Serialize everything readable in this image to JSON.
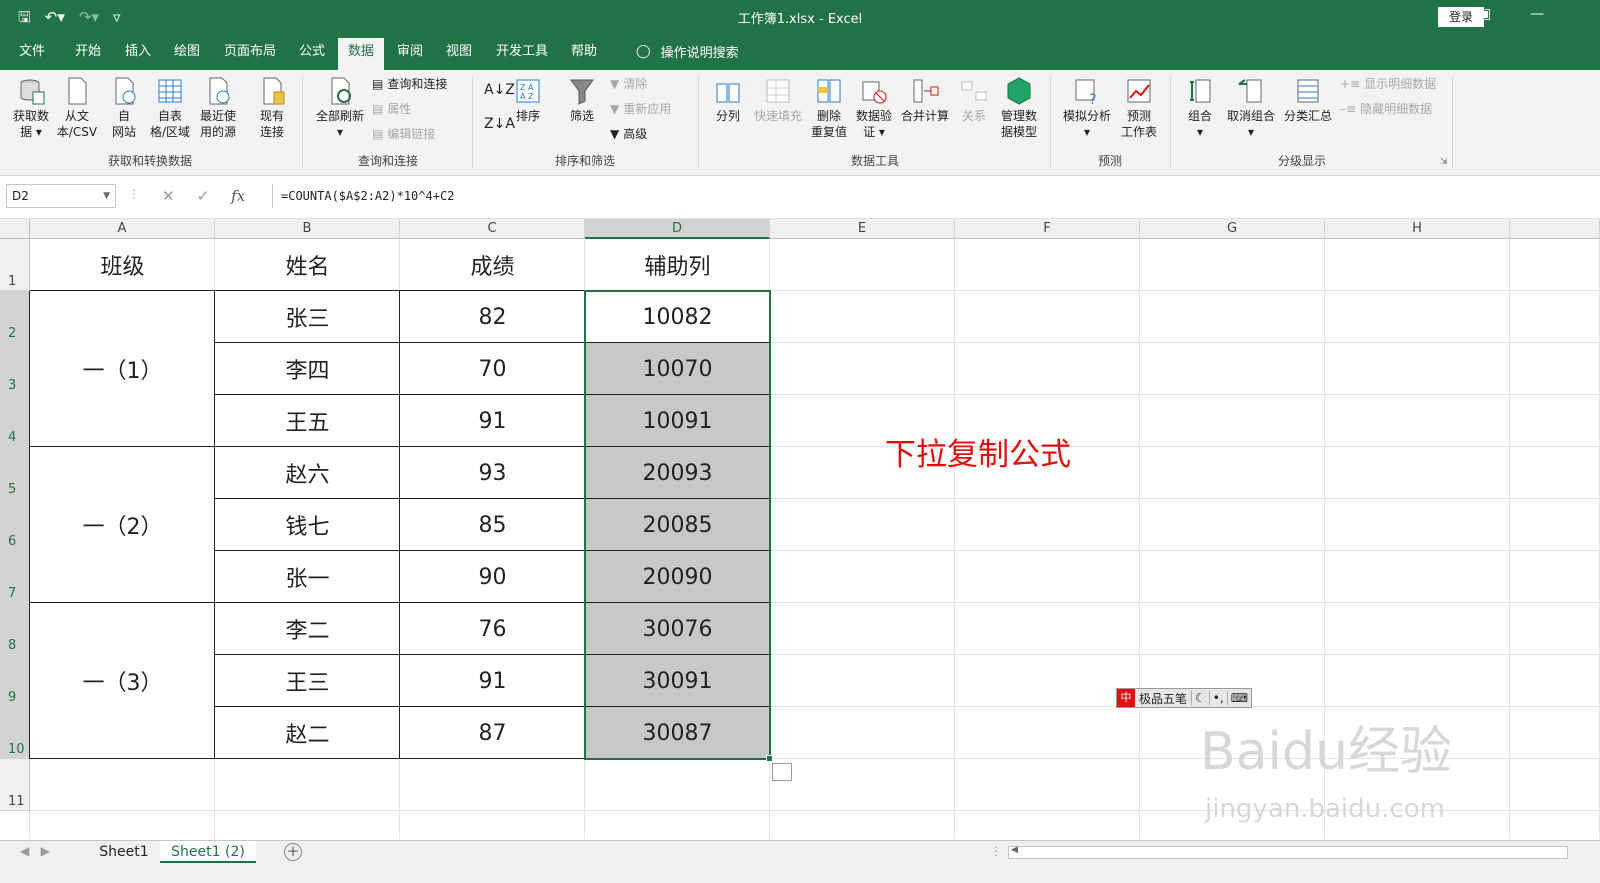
{
  "window": {
    "title": "工作簿1.xlsx  -  Excel",
    "login_label": "登录",
    "qat_icons": [
      "save-icon",
      "undo-icon",
      "redo-icon",
      "customize-icon"
    ]
  },
  "menu": {
    "tabs": [
      {
        "label": "文件",
        "active": false
      },
      {
        "label": "开始",
        "active": false
      },
      {
        "label": "插入",
        "active": false
      },
      {
        "label": "绘图",
        "active": false
      },
      {
        "label": "页面布局",
        "active": false
      },
      {
        "label": "公式",
        "active": false
      },
      {
        "label": "数据",
        "active": true
      },
      {
        "label": "审阅",
        "active": false
      },
      {
        "label": "视图",
        "active": false
      },
      {
        "label": "开发工具",
        "active": false
      },
      {
        "label": "帮助",
        "active": false
      }
    ],
    "search_label": "操作说明搜索"
  },
  "ribbon": {
    "get_data": {
      "l1": "获取数",
      "l2": "据"
    },
    "from_text": {
      "l1": "从文",
      "l2": "本/CSV"
    },
    "from_web": {
      "l1": "自",
      "l2": "网站"
    },
    "from_table": {
      "l1": "自表",
      "l2": "格/区域"
    },
    "recent_sources": {
      "l1": "最近使",
      "l2": "用的源"
    },
    "existing_conn": {
      "l1": "现有",
      "l2": "连接"
    },
    "group1_label": "获取和转换数据",
    "refresh_all": "全部刷新",
    "queries_conn": "查询和连接",
    "properties": "属性",
    "edit_links": "编辑链接",
    "group2_label": "查询和连接",
    "sort": "排序",
    "filter": "筛选",
    "clear": "清除",
    "reapply": "重新应用",
    "advanced": "高级",
    "group3_label": "排序和筛选",
    "text_to_col": "分列",
    "flash_fill": "快速填充",
    "remove_dup": {
      "l1": "删除",
      "l2": "重复值"
    },
    "data_valid": {
      "l1": "数据验",
      "l2": "证"
    },
    "consolidate": "合并计算",
    "relations": "关系",
    "data_model": {
      "l1": "管理数",
      "l2": "据模型"
    },
    "group4_label": "数据工具",
    "what_if": "模拟分析",
    "forecast": {
      "l1": "预测",
      "l2": "工作表"
    },
    "group5_label": "预测",
    "group": "组合",
    "ungroup": "取消组合",
    "subtotal": "分类汇总",
    "show_detail": "显示明细数据",
    "hide_detail": "隐藏明细数据",
    "group6_label": "分级显示"
  },
  "formula_bar": {
    "name_box": "D2",
    "formula": "=COUNTA($A$2:A2)*10^4+C2"
  },
  "columns": [
    "A",
    "B",
    "C",
    "D",
    "E",
    "F",
    "G",
    "H"
  ],
  "rows": [
    "1",
    "2",
    "3",
    "4",
    "5",
    "6",
    "7",
    "8",
    "9",
    "10",
    "11"
  ],
  "table": {
    "headers": [
      "班级",
      "姓名",
      "成绩",
      "辅助列"
    ],
    "classes": [
      "一（1）",
      "一（2）",
      "一（3）"
    ],
    "names": [
      "张三",
      "李四",
      "王五",
      "赵六",
      "钱七",
      "张一",
      "李二",
      "王三",
      "赵二"
    ],
    "scores": [
      "82",
      "70",
      "91",
      "93",
      "85",
      "90",
      "76",
      "91",
      "87"
    ],
    "helper": [
      "10082",
      "10070",
      "10091",
      "20093",
      "20085",
      "20090",
      "30076",
      "30091",
      "30087"
    ]
  },
  "annotation": "下拉复制公式",
  "ime": {
    "zh": "中",
    "label": "极品五笔"
  },
  "watermark": {
    "l1": "Baidu经验",
    "l2": "jingyan.baidu.com"
  },
  "sheets": [
    {
      "label": "Sheet1",
      "active": false
    },
    {
      "label": "Sheet1 (2)",
      "active": true
    }
  ],
  "colors": {
    "excel_green": "#217346",
    "note_red": "#e01010",
    "selection_fill": "#c8c8c8"
  }
}
